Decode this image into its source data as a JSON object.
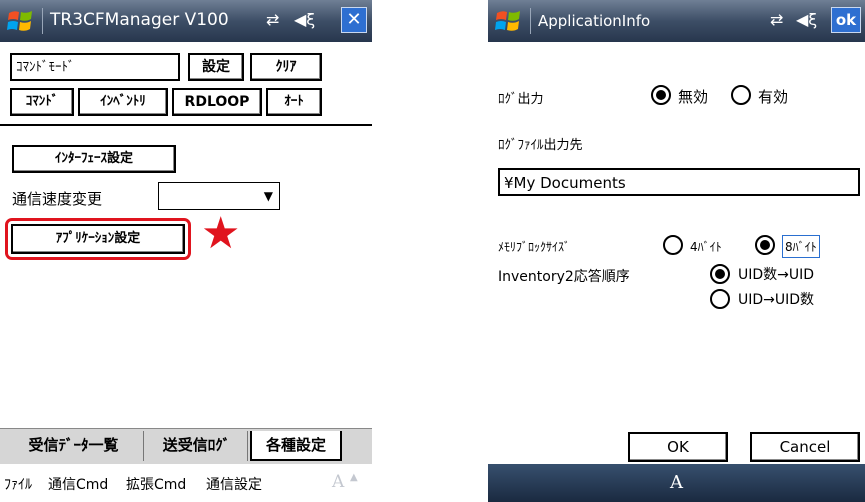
{
  "left_window": {
    "title": "TR3CFManager V100",
    "mode_field": "ｺﾏﾝﾄﾞﾓｰﾄﾞ",
    "btn_settings": "設定",
    "btn_clear": "ｸﾘｱ",
    "btn_command": "ｺﾏﾝﾄﾞ",
    "btn_inventory": "ｲﾝﾍﾞﾝﾄﾘ",
    "btn_rdloop": "RDLOOP",
    "btn_auto": "ｵｰﾄ",
    "btn_interface": "ｲﾝﾀｰﾌｪｰｽ設定",
    "baud_label": "通信速度変更",
    "baud_value": "",
    "btn_app_settings": "ｱﾌﾟﾘｹｰｼｮﾝ設定",
    "annotation_star": "★",
    "annotation_color": "#e0141e",
    "tabs": [
      "受信ﾃﾞｰﾀ一覧",
      "送受信ﾛｸﾞ",
      "各種設定"
    ],
    "active_tab": "各種設定",
    "menu": [
      "ﾌｧｲﾙ",
      "通信Cmd",
      "拡張Cmd",
      "通信設定"
    ],
    "sip_glyph": "A"
  },
  "right_window": {
    "title": "ApplicationInfo",
    "ok_label": "ok",
    "log_output_label": "ﾛｸﾞ出力",
    "log_off": "無効",
    "log_on": "有効",
    "log_selected": "無効",
    "log_dest_label": "ﾛｸﾞﾌｧｲﾙ出力先",
    "log_dest_value": "¥My Documents",
    "block_size_label": "ﾒﾓﾘﾌﾞﾛｯｸｻｲｽﾞ",
    "block_4": "4ﾊﾞｲﾄ",
    "block_8": "8ﾊﾞｲﾄ",
    "block_selected": "8ﾊﾞｲﾄ",
    "inventory_label": "Inventory2応答順序",
    "inv_opt1": "UID数→UID",
    "inv_opt2": "UID→UID数",
    "inv_selected": "UID数→UID",
    "btn_ok": "OK",
    "btn_cancel": "Cancel",
    "sip_glyph": "A"
  }
}
